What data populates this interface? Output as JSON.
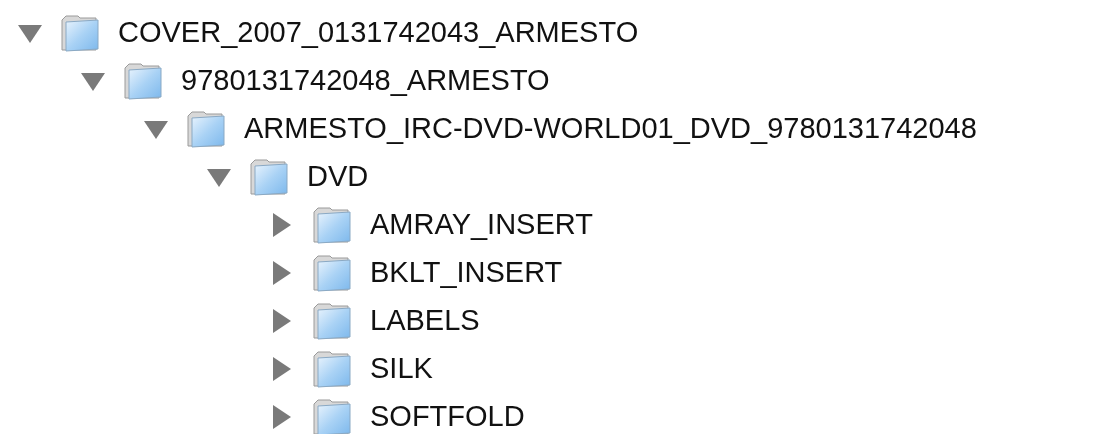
{
  "tree": [
    {
      "label": "COVER_2007_0131742043_ARMESTO",
      "expanded": true,
      "children": [
        {
          "label": "9780131742048_ARMESTO",
          "expanded": true,
          "children": [
            {
              "label": "ARMESTO_IRC-DVD-WORLD01_DVD_9780131742048",
              "expanded": true,
              "children": [
                {
                  "label": "DVD",
                  "expanded": true,
                  "children": [
                    {
                      "label": "AMRAY_INSERT",
                      "expanded": false
                    },
                    {
                      "label": "BKLT_INSERT",
                      "expanded": false
                    },
                    {
                      "label": "LABELS",
                      "expanded": false
                    },
                    {
                      "label": "SILK",
                      "expanded": false
                    },
                    {
                      "label": "SOFTFOLD",
                      "expanded": false
                    }
                  ]
                }
              ]
            }
          ]
        }
      ]
    }
  ]
}
